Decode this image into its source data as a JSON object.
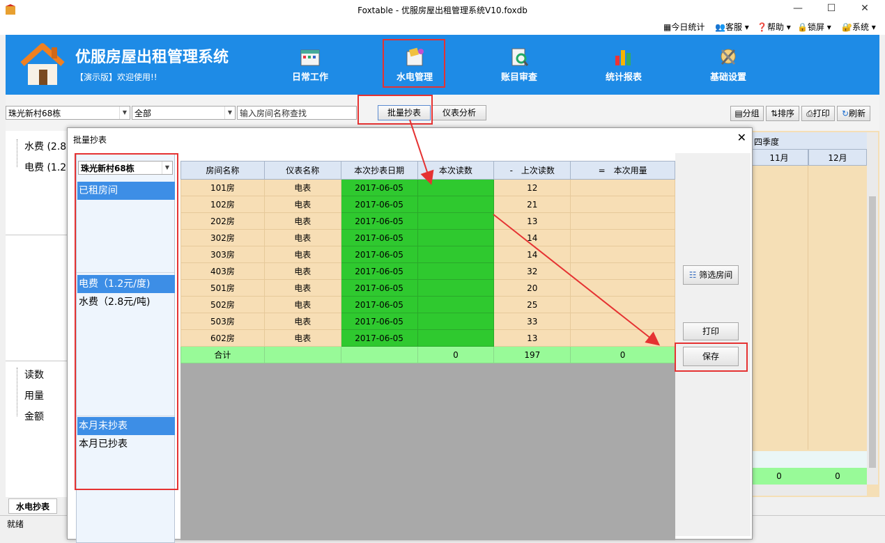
{
  "window": {
    "title": "Foxtable - 优服房屋出租管理系统V10.foxdb"
  },
  "top_menu": [
    "今日统计",
    "客服",
    "帮助",
    "锁屏",
    "系统"
  ],
  "app": {
    "name": "优服房屋出租管理系统",
    "subtitle": "【演示版】欢迎使用!!"
  },
  "nav": [
    "日常工作",
    "水电管理",
    "账目审查",
    "统计报表",
    "基础设置"
  ],
  "toolbar": {
    "building": "珠光新村68栋",
    "filter": "全部",
    "search_value": "输入房间名称查找",
    "batch_btn": "批量抄表",
    "meter_btn": "仪表分析",
    "right_buttons": [
      "分组",
      "排序",
      "打印",
      "刷新"
    ]
  },
  "background": {
    "left_tree_top": [
      "水费 (2.8",
      "电费 (1.2"
    ],
    "left_tree_bottom": [
      "读数",
      "用量",
      "金额"
    ],
    "quarter": "四季度",
    "months": [
      "11月",
      "12月"
    ],
    "totals": [
      "0",
      "0"
    ],
    "tab": "水电抄表",
    "status": "就绪"
  },
  "dialog": {
    "title": "批量抄表",
    "building": "珠光新村68栋",
    "groups": [
      {
        "label": "已租房间",
        "selected": true
      },
      {
        "label": "电费（1.2元/度)",
        "selected": true
      },
      {
        "label": "水费（2.8元/吨)",
        "selected": false
      },
      {
        "label": "本月未抄表",
        "selected": true
      },
      {
        "label": "本月已抄表",
        "selected": false
      }
    ],
    "columns": [
      "房间名称",
      "仪表名称",
      "本次抄表日期",
      "本次读数",
      "-　上次读数",
      "=　本次用量"
    ],
    "rows": [
      [
        "101房",
        "电表",
        "2017-06-05",
        "",
        "12",
        ""
      ],
      [
        "102房",
        "电表",
        "2017-06-05",
        "",
        "21",
        ""
      ],
      [
        "202房",
        "电表",
        "2017-06-05",
        "",
        "13",
        ""
      ],
      [
        "302房",
        "电表",
        "2017-06-05",
        "",
        "14",
        ""
      ],
      [
        "303房",
        "电表",
        "2017-06-05",
        "",
        "14",
        ""
      ],
      [
        "403房",
        "电表",
        "2017-06-05",
        "",
        "32",
        ""
      ],
      [
        "501房",
        "电表",
        "2017-06-05",
        "",
        "20",
        ""
      ],
      [
        "502房",
        "电表",
        "2017-06-05",
        "",
        "25",
        ""
      ],
      [
        "503房",
        "电表",
        "2017-06-05",
        "",
        "33",
        ""
      ],
      [
        "602房",
        "电表",
        "2017-06-05",
        "",
        "13",
        ""
      ]
    ],
    "total_row": [
      "合计",
      "",
      "",
      "0",
      "197",
      "0"
    ],
    "buttons": {
      "filter": "筛选房间",
      "print": "打印",
      "save": "保存"
    }
  },
  "colors": {
    "banner": "#1e8be6",
    "highlight": "#e53232",
    "green_cell": "#2fc92f",
    "row_bg": "#f7deb5",
    "total_bg": "#98fa98"
  }
}
